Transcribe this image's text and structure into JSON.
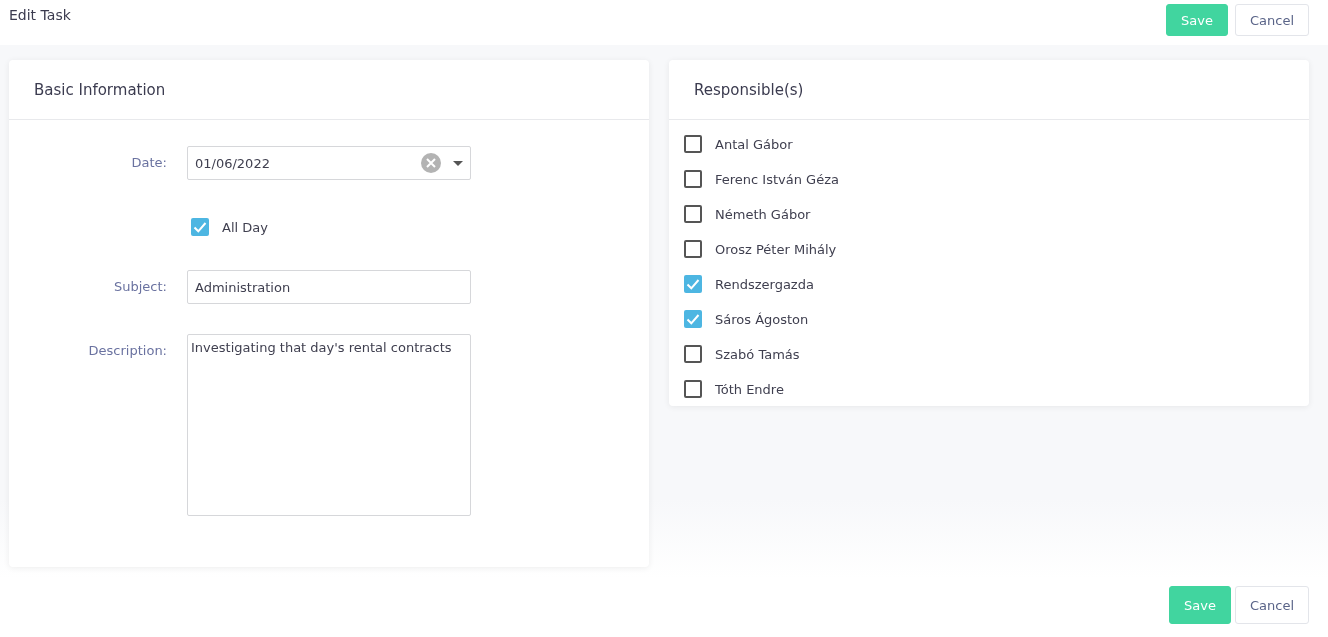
{
  "header": {
    "title": "Edit Task",
    "buttons": [
      {
        "label": "Save",
        "kind": "primary"
      },
      {
        "label": "Cancel",
        "kind": "secondary"
      }
    ]
  },
  "basic_information": {
    "title": "Basic Information",
    "date": {
      "label": "Date:",
      "value": "01/06/2022"
    },
    "all_day": {
      "label": "All Day",
      "checked": true
    },
    "subject": {
      "label": "Subject:",
      "value": "Administration"
    },
    "description": {
      "label": "Description:",
      "value": "Investigating that day's rental contracts"
    }
  },
  "responsibles": {
    "title": "Responsible(s)",
    "items": [
      {
        "name": "Antal Gábor",
        "checked": false
      },
      {
        "name": "Ferenc István Géza",
        "checked": false
      },
      {
        "name": "Németh Gábor",
        "checked": false
      },
      {
        "name": "Orosz Péter Mihály",
        "checked": false
      },
      {
        "name": "Rendszergazda",
        "checked": true
      },
      {
        "name": "Sáros Ágoston",
        "checked": true
      },
      {
        "name": "Szabó Tamás",
        "checked": false
      },
      {
        "name": "Tóth Endre",
        "checked": false
      }
    ]
  },
  "footer_buttons": [
    {
      "label": "Save",
      "kind": "primary"
    },
    {
      "label": "Cancel",
      "kind": "secondary"
    }
  ]
}
